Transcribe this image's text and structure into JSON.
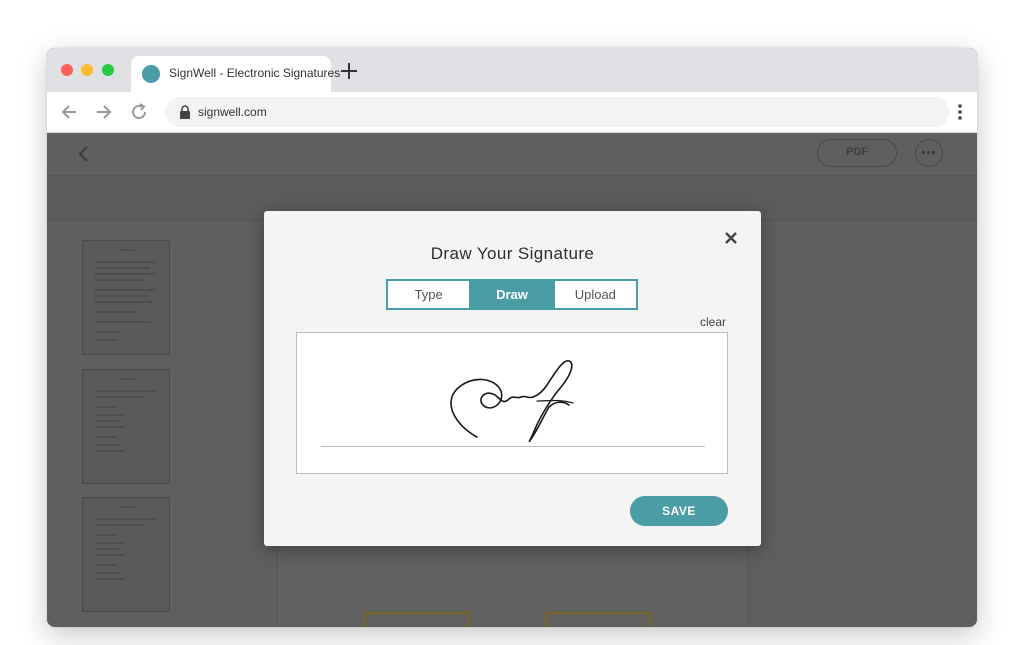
{
  "browser": {
    "tab_title": "SignWell - Electronic Signatures",
    "url": "signwell.com",
    "accent_color": "#4a9ca5"
  },
  "app": {
    "pdf_label": "PDF"
  },
  "modal": {
    "title": "Draw Your Signature",
    "tabs": [
      {
        "label": "Type",
        "active": false
      },
      {
        "label": "Draw",
        "active": true
      },
      {
        "label": "Upload",
        "active": false
      }
    ],
    "clear_label": "clear",
    "save_label": "SAVE"
  },
  "icons": [
    "back-arrow-icon",
    "forward-arrow-icon",
    "reload-icon",
    "lock-icon",
    "close-icon",
    "new-tab-icon",
    "more-options-icon",
    "menu-dots-icon"
  ]
}
